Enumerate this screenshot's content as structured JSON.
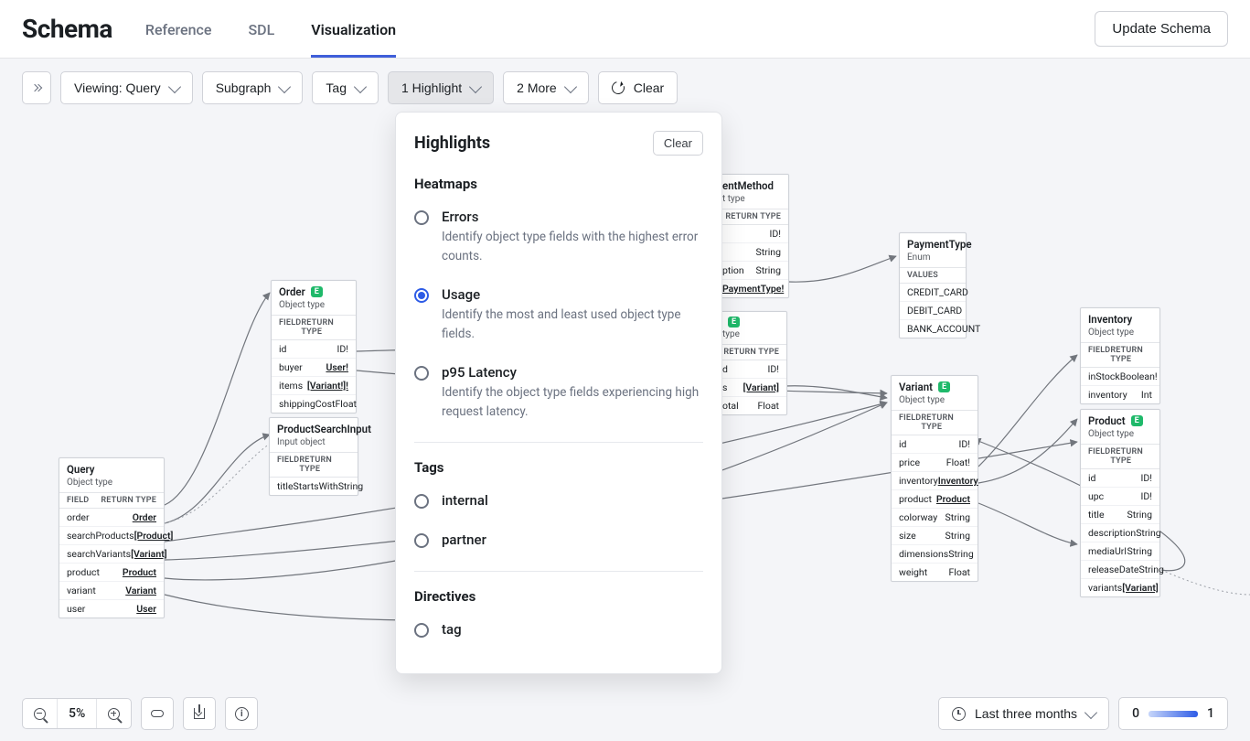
{
  "header": {
    "title": "Schema",
    "tabs": [
      "Reference",
      "SDL",
      "Visualization"
    ],
    "active_tab": "Visualization",
    "update_btn": "Update Schema"
  },
  "toolbar": {
    "viewing": "Viewing: Query",
    "subgraph": "Subgraph",
    "tag": "Tag",
    "highlight": "1 Highlight",
    "more": "2 More",
    "clear": "Clear"
  },
  "popover": {
    "title": "Highlights",
    "clear": "Clear",
    "sections": {
      "heatmaps": {
        "title": "Heatmaps",
        "options": [
          {
            "key": "errors",
            "label": "Errors",
            "desc": "Identify object type fields with the highest error counts.",
            "selected": false
          },
          {
            "key": "usage",
            "label": "Usage",
            "desc": "Identify the most and least used object type fields.",
            "selected": true
          },
          {
            "key": "latency",
            "label": "p95 Latency",
            "desc": "Identify the object type fields experiencing high request latency.",
            "selected": false
          }
        ]
      },
      "tags": {
        "title": "Tags",
        "options": [
          {
            "key": "internal",
            "label": "internal",
            "selected": false
          },
          {
            "key": "partner",
            "label": "partner",
            "selected": false
          }
        ]
      },
      "directives": {
        "title": "Directives",
        "options": [
          {
            "key": "tag",
            "label": "tag",
            "selected": false
          }
        ]
      }
    }
  },
  "nodes": {
    "query": {
      "name": "Query",
      "subtype": "Object type",
      "entity": false,
      "field_h": "FIELD",
      "return_h": "RETURN TYPE",
      "fields": [
        {
          "n": "order",
          "t": "Order",
          "link": true
        },
        {
          "n": "searchProducts",
          "t": "[Product]",
          "link": true
        },
        {
          "n": "searchVariants",
          "t": "[Variant]",
          "link": true
        },
        {
          "n": "product",
          "t": "Product",
          "link": true
        },
        {
          "n": "variant",
          "t": "Variant",
          "link": true
        },
        {
          "n": "user",
          "t": "User",
          "link": true
        }
      ]
    },
    "order": {
      "name": "Order",
      "subtype": "Object type",
      "entity": true,
      "field_h": "FIELD",
      "return_h": "RETURN TYPE",
      "fields": [
        {
          "n": "id",
          "t": "ID!",
          "link": false
        },
        {
          "n": "buyer",
          "t": "User!",
          "link": true
        },
        {
          "n": "items",
          "t": "[Variant!]!",
          "link": true
        },
        {
          "n": "shippingCost",
          "t": "Float",
          "link": false
        }
      ]
    },
    "productSearchInput": {
      "name": "ProductSearchInput",
      "subtype": "Input object",
      "entity": false,
      "field_h": "FIELD",
      "return_h": "RETURN TYPE",
      "fields": [
        {
          "n": "titleStartsWith",
          "t": "String",
          "link": false
        }
      ]
    },
    "paymentMethod_partial": {
      "name": "entMethod",
      "subtype": "t type",
      "entity": false,
      "return_h": "RETURN TYPE",
      "fields": [
        {
          "n": "",
          "t": "ID!",
          "link": false
        },
        {
          "n": "",
          "t": "String",
          "link": false
        },
        {
          "n": "ption",
          "t": "String",
          "link": false
        },
        {
          "n": "",
          "t": "PaymentType!",
          "link": true
        }
      ]
    },
    "cart_partial": {
      "name": "",
      "subtype": "type",
      "entity": true,
      "return_h": "RETURN TYPE",
      "fields": [
        {
          "n": "d",
          "t": "ID!",
          "link": false
        },
        {
          "n": "s",
          "t": "[Variant]",
          "link": true
        },
        {
          "n": "otal",
          "t": "Float",
          "link": false
        }
      ]
    },
    "paymentType": {
      "name": "PaymentType",
      "subtype": "Enum",
      "values_h": "VALUES",
      "values": [
        "CREDIT_CARD",
        "DEBIT_CARD",
        "BANK_ACCOUNT"
      ]
    },
    "variant": {
      "name": "Variant",
      "subtype": "Object type",
      "entity": true,
      "field_h": "FIELD",
      "return_h": "RETURN TYPE",
      "fields": [
        {
          "n": "id",
          "t": "ID!",
          "link": false
        },
        {
          "n": "price",
          "t": "Float!",
          "link": false
        },
        {
          "n": "inventory",
          "t": "Inventory",
          "link": true
        },
        {
          "n": "product",
          "t": "Product",
          "link": true
        },
        {
          "n": "colorway",
          "t": "String",
          "link": false
        },
        {
          "n": "size",
          "t": "String",
          "link": false
        },
        {
          "n": "dimensions",
          "t": "String",
          "link": false
        },
        {
          "n": "weight",
          "t": "Float",
          "link": false
        }
      ]
    },
    "inventory": {
      "name": "Inventory",
      "subtype": "Object type",
      "entity": false,
      "field_h": "FIELD",
      "return_h": "RETURN TYPE",
      "fields": [
        {
          "n": "inStock",
          "t": "Boolean!",
          "link": false
        },
        {
          "n": "inventory",
          "t": "Int",
          "link": false
        }
      ]
    },
    "product": {
      "name": "Product",
      "subtype": "Object type",
      "entity": true,
      "field_h": "FIELD",
      "return_h": "RETURN TYPE",
      "fields": [
        {
          "n": "id",
          "t": "ID!",
          "link": false
        },
        {
          "n": "upc",
          "t": "ID!",
          "link": false
        },
        {
          "n": "title",
          "t": "String",
          "link": false
        },
        {
          "n": "description",
          "t": "String",
          "link": false
        },
        {
          "n": "mediaUrl",
          "t": "String",
          "link": false
        },
        {
          "n": "releaseDate",
          "t": "String",
          "link": false
        },
        {
          "n": "variants",
          "t": "[Variant]",
          "link": true
        }
      ]
    }
  },
  "footer": {
    "zoom": "5%",
    "timeframe": "Last three months",
    "legend_min": "0",
    "legend_max": "1"
  }
}
